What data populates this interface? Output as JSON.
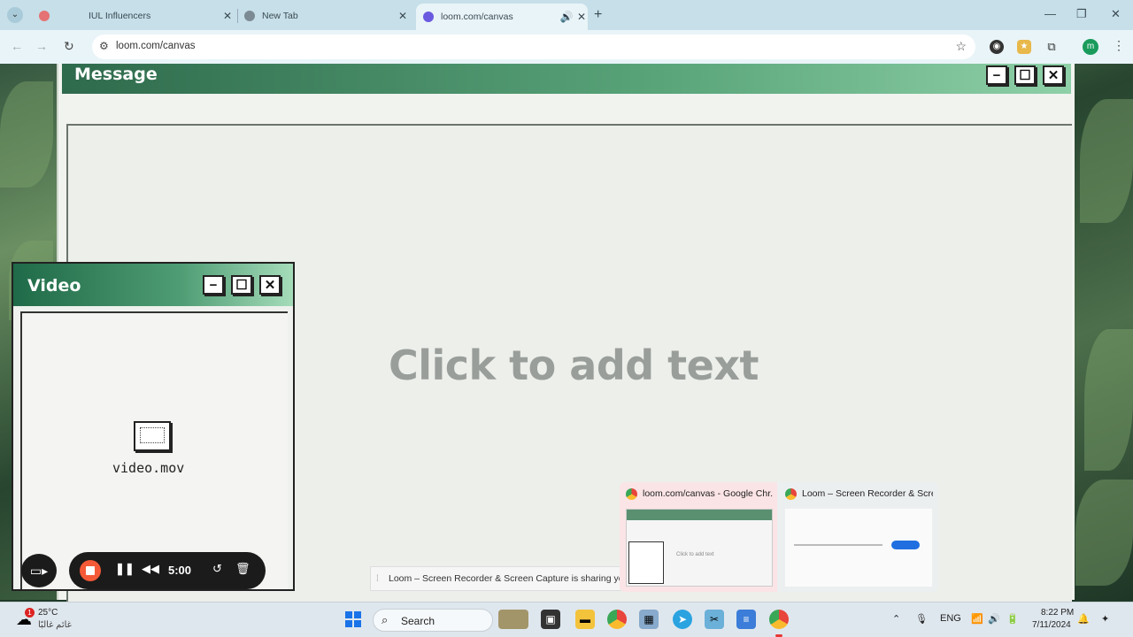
{
  "browser": {
    "tabs": [
      {
        "title": "IUL Influencers",
        "active": false
      },
      {
        "title": "New Tab",
        "active": false
      },
      {
        "title": "loom.com/canvas",
        "active": true
      }
    ],
    "address": "loom.com/canvas",
    "profile_initial": "m"
  },
  "canvas": {
    "message_window": {
      "title": "Message",
      "placeholder": "Click to add text"
    },
    "video_window": {
      "title": "Video",
      "file_name": "video.mov"
    },
    "window_buttons": {
      "minimize": "−",
      "maximize": "☐",
      "close": "✕"
    }
  },
  "recorder": {
    "time": "5:00"
  },
  "sharing_bar": {
    "text": "Loom – Screen Recorder & Screen Capture is sharing your s"
  },
  "taskbar_preview": {
    "items": [
      {
        "title": "loom.com/canvas - Google Chr..."
      },
      {
        "title": "Loom – Screen Recorder & Scre..."
      }
    ],
    "thumb_text": "Click to add text"
  },
  "taskbar": {
    "weather_temp": "25°C",
    "weather_desc": "غائم غالبًا",
    "weather_badge": "1",
    "search_label": "Search",
    "language": "ENG",
    "time": "8:22 PM",
    "date": "7/11/2024"
  }
}
